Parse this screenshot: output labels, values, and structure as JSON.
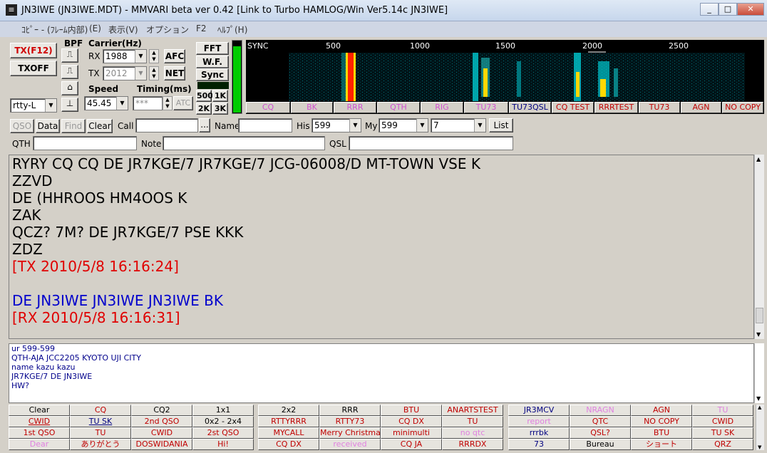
{
  "window": {
    "title": "JN3IWE (JN3IWE.MDT) - MMVARI beta ver 0.42 [Link to Turbo HAMLOG/Win Ver5.14c JN3IWE]",
    "btn_min": "_",
    "btn_max": "□",
    "btn_close": "✕"
  },
  "menu": [
    "ｺﾋﾟｰ - (ﾌﾚｰﾑ内部)",
    "(E)",
    "表示(V)",
    "オプション",
    "F2",
    "ﾍﾙﾌﾟ(H)"
  ],
  "controls": {
    "tx_btn": "TX(F12)",
    "txoff_btn": "TXOFF",
    "bpf_label": "BPF",
    "mode_value": "rtty-L",
    "carrier_label": "Carrier(Hz)",
    "rx_label": "RX",
    "rx_value": "1988",
    "tx_label": "TX",
    "tx_value": "2012",
    "afc_btn": "AFC",
    "net_btn": "NET",
    "speed_label": "Speed",
    "speed_value": "45.45",
    "timing_label": "Timing(ms)",
    "timing_value": "***",
    "atc_btn": "ATC",
    "fft_btn": "FFT",
    "wf_btn": "W.F.",
    "sync_btn": "Sync",
    "bw_500": "500",
    "bw_1k": "1K",
    "bw_2k": "2K",
    "bw_3k": "3K"
  },
  "waterfall": {
    "scale": [
      "SYNC",
      "500",
      "1000",
      "1500",
      "2000",
      "2500"
    ],
    "tabs": [
      {
        "label": "CQ",
        "color": "#d050d0"
      },
      {
        "label": "BK",
        "color": "#d050d0"
      },
      {
        "label": "RRR",
        "color": "#d050d0"
      },
      {
        "label": "QTH",
        "color": "#d050d0"
      },
      {
        "label": "RIG",
        "color": "#d050d0"
      },
      {
        "label": "TU73",
        "color": "#d050d0"
      },
      {
        "label": "TU73QSL",
        "color": "#000080"
      },
      {
        "label": "CQ TEST",
        "color": "#c00000"
      },
      {
        "label": "RRRTEST",
        "color": "#c00000"
      },
      {
        "label": "TU73",
        "color": "#c00000"
      },
      {
        "label": "AGN",
        "color": "#c00000"
      },
      {
        "label": "NO COPY",
        "color": "#c00000"
      }
    ]
  },
  "log": {
    "qso_btn": "QSO",
    "data_btn": "Data",
    "find_btn": "Find",
    "clear_btn": "Clear",
    "call_label": "Call",
    "call_value": "",
    "dots_btn": "...",
    "name_label": "Name",
    "his_label": "His",
    "his_value": "599",
    "my_label": "My",
    "my_value": "599",
    "band_value": "7",
    "list_btn": "List",
    "qth_label": "QTH",
    "note_label": "Note",
    "qsl_label": "QSL"
  },
  "rx_lines": [
    {
      "text": "RYRY CQ CQ DE JR7KGE/7 JR7KGE/7 JCG-06008/D MT-TOWN VSE K",
      "color": "#000000"
    },
    {
      "text": "ZZVD",
      "color": "#000000"
    },
    {
      "text": "DE (HHROOS HM4OOS K",
      "color": "#000000"
    },
    {
      "text": "ZAK",
      "color": "#000000"
    },
    {
      "text": "QCZ? 7M? DE JR7KGE/7 PSE KKK",
      "color": "#000000"
    },
    {
      "text": "ZDZ",
      "color": "#000000"
    },
    {
      "text": "[TX 2010/5/8 16:16:24]",
      "color": "#e00000"
    },
    {
      "text": " ",
      "color": "#000000"
    },
    {
      "text": "DE JN3IWE JN3IWE JN3IWE BK",
      "color": "#0000cc"
    },
    {
      "text": "[RX 2010/5/8 16:16:31]",
      "color": "#e00000"
    }
  ],
  "tx_lines": [
    "ur 599-599",
    "QTH-AJA JCC2205 KYOTO UJI CITY",
    "name kazu kazu",
    "JR7KGE/7 DE JN3IWE",
    "HW?"
  ],
  "macros": [
    [
      {
        "label": "Clear",
        "color": "#000000"
      },
      {
        "label": "CQ",
        "color": "#c00000"
      },
      {
        "label": "CQ2",
        "color": "#000000"
      },
      {
        "label": "1x1",
        "color": "#000000"
      },
      {
        "label": "2x2",
        "color": "#000000"
      },
      {
        "label": "RRR",
        "color": "#000000"
      },
      {
        "label": "BTU",
        "color": "#c00000"
      },
      {
        "label": "ANARTSTEST",
        "color": "#c00000"
      },
      {
        "label": "JR3MCV",
        "color": "#000080"
      },
      {
        "label": "NRAGN",
        "color": "#e080e0"
      },
      {
        "label": "AGN",
        "color": "#c00000"
      },
      {
        "label": "TU",
        "color": "#e080e0"
      }
    ],
    [
      {
        "label": "CWID",
        "color": "#c00000"
      },
      {
        "label": "TU SK",
        "color": "#000080"
      },
      {
        "label": "2nd QSO",
        "color": "#c00000"
      },
      {
        "label": "0x2 - 2x4",
        "color": "#000000"
      },
      {
        "label": "RTTYRRR",
        "color": "#c00000"
      },
      {
        "label": "RTTY73",
        "color": "#c00000"
      },
      {
        "label": "CQ DX",
        "color": "#c00000"
      },
      {
        "label": "TU",
        "color": "#c00000"
      },
      {
        "label": "report",
        "color": "#e080e0"
      },
      {
        "label": "QTC",
        "color": "#c00000"
      },
      {
        "label": "NO COPY",
        "color": "#c00000"
      },
      {
        "label": "CWID",
        "color": "#c00000"
      }
    ],
    [
      {
        "label": "1st QSO",
        "color": "#c00000"
      },
      {
        "label": "TU",
        "color": "#c00000"
      },
      {
        "label": "CWID",
        "color": "#c00000"
      },
      {
        "label": "2st QSO",
        "color": "#c00000"
      },
      {
        "label": "MYCALL",
        "color": "#c00000"
      },
      {
        "label": "Merry Christmas",
        "color": "#c00000"
      },
      {
        "label": "minimulti",
        "color": "#c00000"
      },
      {
        "label": "no qtc",
        "color": "#e080e0"
      },
      {
        "label": "rrrbk",
        "color": "#000080"
      },
      {
        "label": "QSL?",
        "color": "#c00000"
      },
      {
        "label": "BTU",
        "color": "#c00000"
      },
      {
        "label": "TU SK",
        "color": "#c00000"
      }
    ],
    [
      {
        "label": "Dear",
        "color": "#e080e0"
      },
      {
        "label": "ありがとう",
        "color": "#c00000"
      },
      {
        "label": "DOSWIDANIA",
        "color": "#c00000"
      },
      {
        "label": "Hi!",
        "color": "#c00000"
      },
      {
        "label": "CQ DX",
        "color": "#c00000"
      },
      {
        "label": "received",
        "color": "#e080e0"
      },
      {
        "label": "CQ JA",
        "color": "#c00000"
      },
      {
        "label": "RRRDX",
        "color": "#c00000"
      },
      {
        "label": "73",
        "color": "#000080"
      },
      {
        "label": "Bureau",
        "color": "#000000"
      },
      {
        "label": "ショート",
        "color": "#c00000"
      },
      {
        "label": "QRZ",
        "color": "#c00000"
      }
    ]
  ]
}
